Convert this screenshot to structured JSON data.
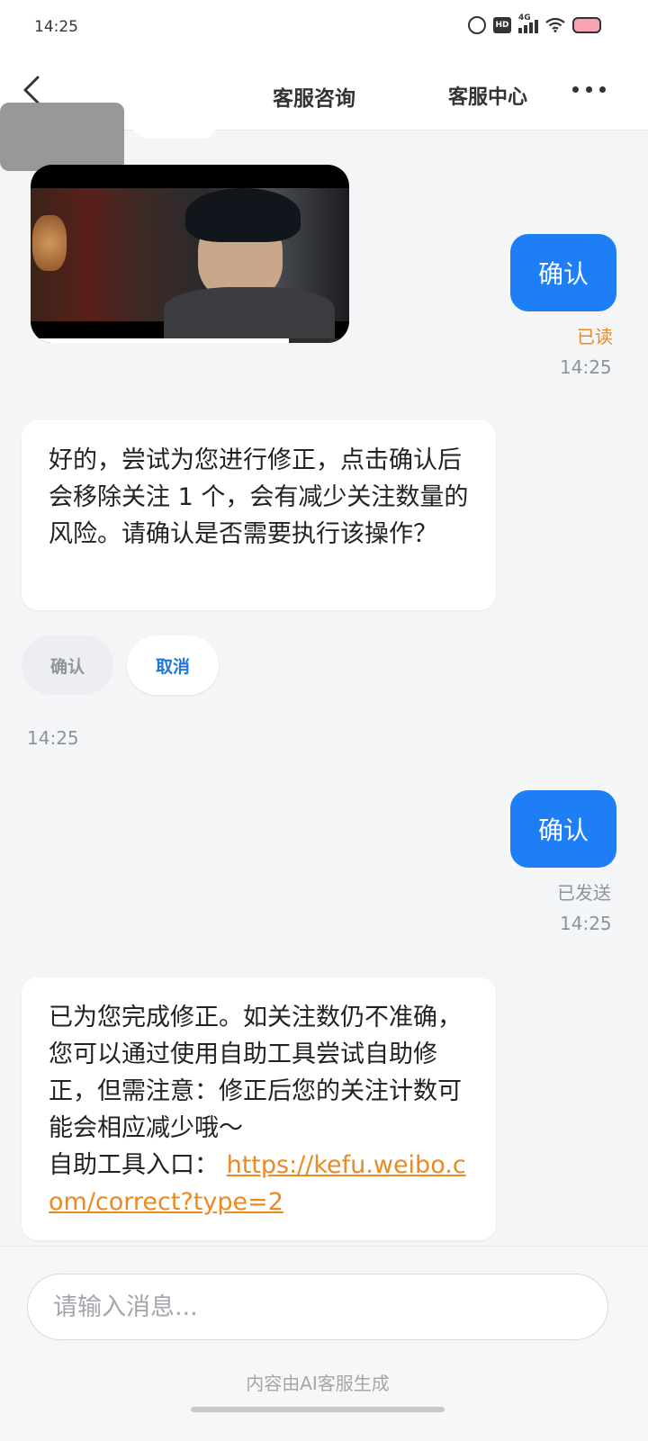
{
  "status_bar": {
    "time": "14:25",
    "icons": [
      "alarm-icon",
      "hd-icon",
      "4g-signal-icon",
      "wifi-icon",
      "battery-icon"
    ],
    "hd_label": "HD",
    "network_label": "4G"
  },
  "nav": {
    "title": "客服咨询",
    "service_center": "客服中心",
    "back_icon": "back-arrow-icon",
    "more_icon": "more-dots-icon"
  },
  "video": {
    "progress_fraction": 0.81
  },
  "messages": {
    "user1": {
      "text": "确认",
      "status": "已读",
      "time": "14:25"
    },
    "agent1": {
      "text": "好的，尝试为您进行修正，点击确认后会移除关注 1 个，会有减少关注数量的风险。请确认是否需要执行该操作？"
    },
    "quick_confirm": "确认",
    "quick_cancel": "取消",
    "agent1_time": "14:25",
    "user2": {
      "text": "确认",
      "status": "已发送",
      "time": "14:25"
    },
    "agent2": {
      "text": "已为您完成修正。如关注数仍不准确，您可以通过使用自助工具尝试自助修正，但需注意：修正后您的关注计数可能会相应减少哦～",
      "entry_label": "自助工具入口：",
      "link": "https://kefu.weibo.com/correct?type=2"
    }
  },
  "input": {
    "placeholder": "请输入消息..."
  },
  "footer": {
    "note": "内容由AI客服生成"
  },
  "colors": {
    "accent": "#1e7ef5",
    "link": "#e98a24",
    "read_status": "#e98a24",
    "background": "#f4f5f7"
  }
}
